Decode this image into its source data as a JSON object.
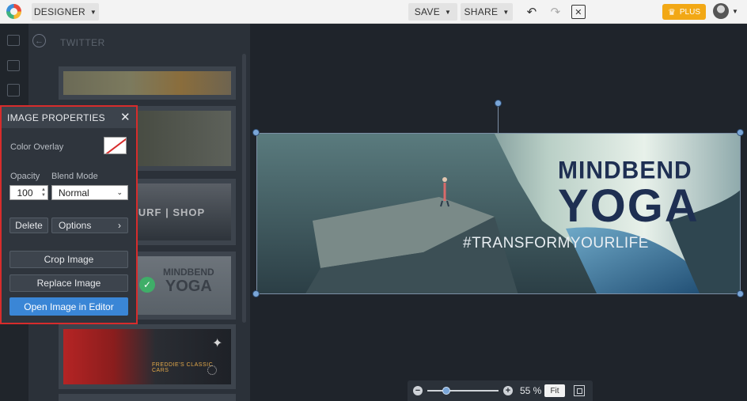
{
  "topbar": {
    "designer_label": "DESIGNER",
    "save_label": "SAVE",
    "share_label": "SHARE",
    "undo_glyph": "↶",
    "redo_glyph": "↷",
    "close_glyph": "✕",
    "plus_label": "PLUS",
    "plus_color": "#f2a815",
    "caret_glyph": "▼"
  },
  "sidebar": {
    "title": "TWITTER",
    "back_glyph": "←",
    "rail_icons": [
      "photo-icon",
      "folder-icon",
      "layout-icon"
    ],
    "templates": [
      {
        "name": "template-runner"
      },
      {
        "name": "template-apple"
      },
      {
        "name": "template-surf-shop",
        "text": "SUZY | SURF | SHOP"
      },
      {
        "name": "template-mindbend-yoga",
        "line1": "MINDBEND",
        "line2": "YOGA",
        "selected": true
      },
      {
        "name": "template-classic-cars",
        "text": "FREDDIE'S CLASSIC CARS"
      }
    ]
  },
  "image_properties": {
    "title": "IMAGE PROPERTIES",
    "close_glyph": "✕",
    "color_overlay_label": "Color Overlay",
    "opacity_label": "Opacity",
    "opacity_value": "100",
    "blend_mode_label": "Blend Mode",
    "blend_mode_value": "Normal",
    "delete_label": "Delete",
    "options_label": "Options",
    "options_chevron": "›",
    "crop_label": "Crop Image",
    "replace_label": "Replace Image",
    "open_editor_label": "Open Image in Editor",
    "accent_color": "#3a86d6",
    "highlight_color": "#d72c2c"
  },
  "canvas": {
    "line1": "MINDBEND",
    "line2": "YOGA",
    "tagline": "#TRANSFORMYOURLIFE"
  },
  "zoom": {
    "minus_glyph": "−",
    "plus_glyph": "+",
    "level": 0.55,
    "value_label": "55 %",
    "fit_label": "Fit"
  }
}
